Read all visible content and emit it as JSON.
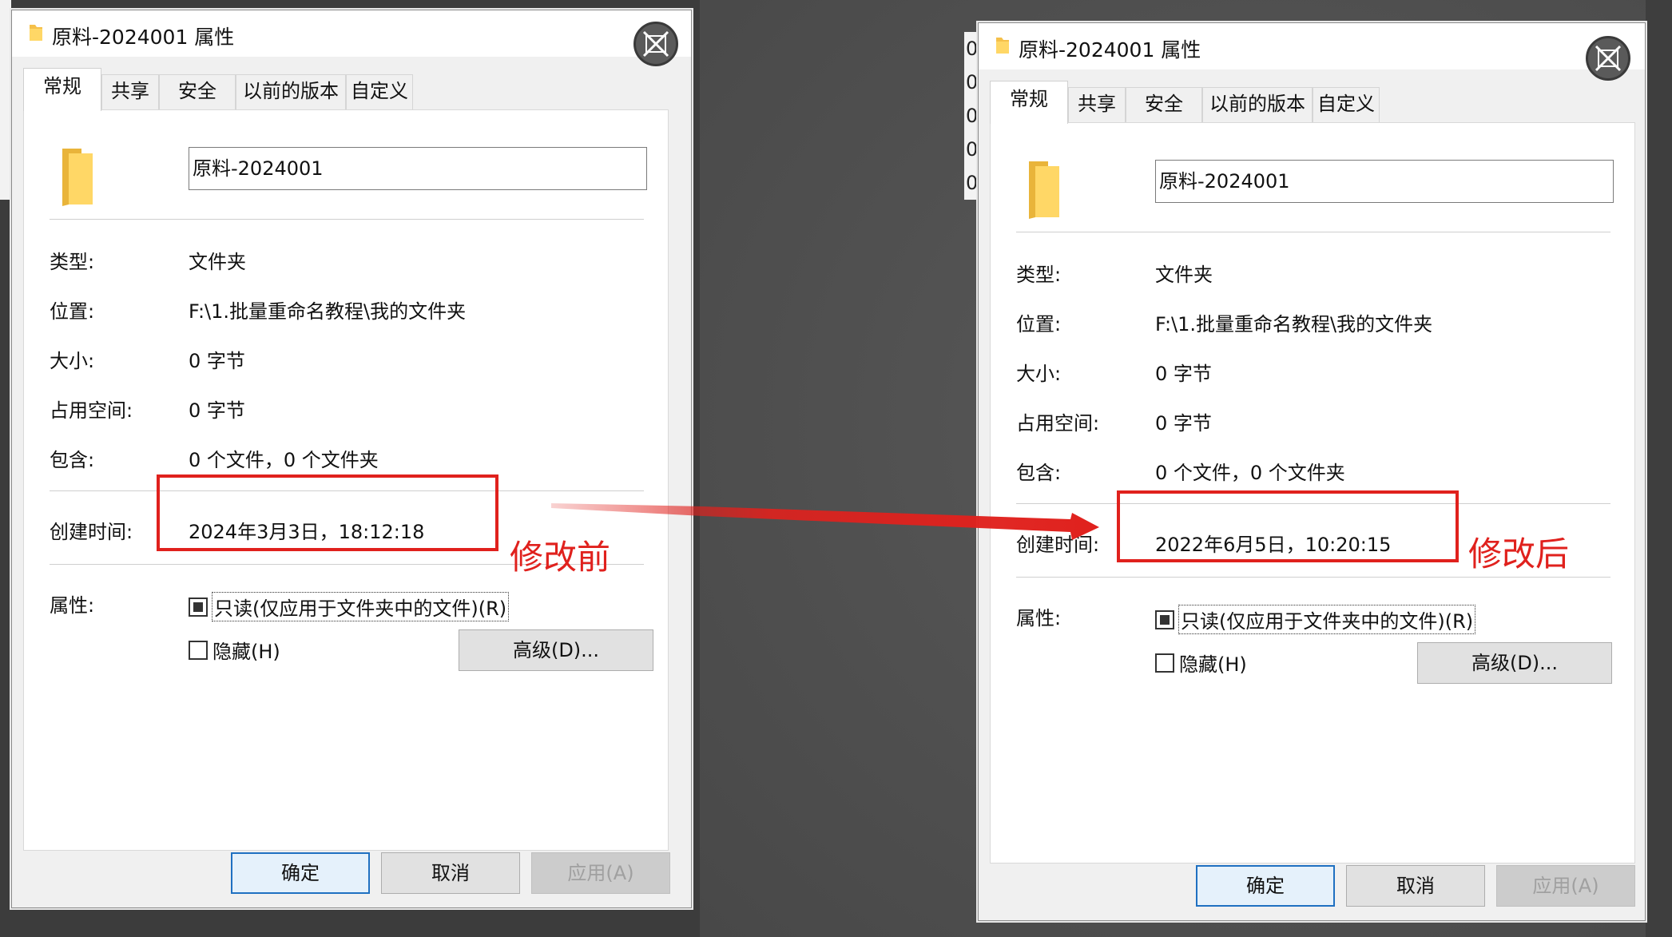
{
  "colors": {
    "annotation_red": "#e0211d",
    "dialog_bg": "#f0f0f0",
    "panel_bg": "#ffffff",
    "default_button_border": "#1f70c1"
  },
  "icons": [
    "folder-icon",
    "translate-close-icon",
    "checkbox-icon",
    "arrow-icon"
  ],
  "left_dialog": {
    "title": "原料-2024001 属性",
    "tabs": [
      "常规",
      "共享",
      "安全",
      "以前的版本",
      "自定义"
    ],
    "name_value": "原料-2024001",
    "rows": [
      {
        "label": "类型:",
        "value": "文件夹"
      },
      {
        "label": "位置:",
        "value": "F:\\1.批量重命名教程\\我的文件夹"
      },
      {
        "label": "大小:",
        "value": "0 字节"
      },
      {
        "label": "占用空间:",
        "value": "0 字节"
      },
      {
        "label": "包含:",
        "value": "0 个文件，0 个文件夹"
      }
    ],
    "created_label": "创建时间:",
    "created_value": "2024年3月3日，18:12:18",
    "attributes_label": "属性:",
    "readonly_label": "只读(仅应用于文件夹中的文件)(R)",
    "hidden_label": "隐藏(H)",
    "advanced_button": "高级(D)...",
    "ok_button": "确定",
    "cancel_button": "取消",
    "apply_button": "应用(A)",
    "annotation": "修改前"
  },
  "right_dialog": {
    "title": "原料-2024001 属性",
    "tabs": [
      "常规",
      "共享",
      "安全",
      "以前的版本",
      "自定义"
    ],
    "name_value": "原料-2024001",
    "rows": [
      {
        "label": "类型:",
        "value": "文件夹"
      },
      {
        "label": "位置:",
        "value": "F:\\1.批量重命名教程\\我的文件夹"
      },
      {
        "label": "大小:",
        "value": "0 字节"
      },
      {
        "label": "占用空间:",
        "value": "0 字节"
      },
      {
        "label": "包含:",
        "value": "0 个文件，0 个文件夹"
      }
    ],
    "created_label": "创建时间:",
    "created_value": "2022年6月5日，10:20:15",
    "attributes_label": "属性:",
    "readonly_label": "只读(仅应用于文件夹中的文件)(R)",
    "hidden_label": "隐藏(H)",
    "advanced_button": "高级(D)...",
    "ok_button": "确定",
    "cancel_button": "取消",
    "apply_button": "应用(A)",
    "annotation": "修改后"
  },
  "background_peek": {
    "chars": [
      "0",
      "0",
      "0",
      "0",
      "0"
    ]
  }
}
